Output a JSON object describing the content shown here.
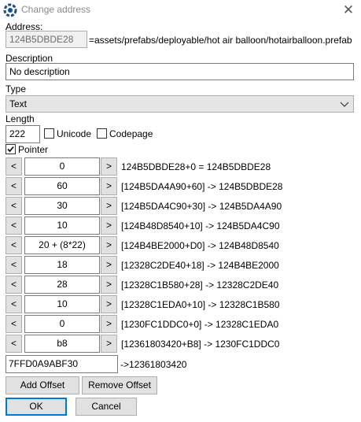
{
  "window": {
    "title": "Change address",
    "close_glyph": "✕",
    "app_icon": "cheat-engine-icon"
  },
  "address": {
    "label": "Address:",
    "value": "124B5DBDE28",
    "symbol_text": "=assets/prefabs/deployable/hot air balloon/hotairballoon.prefab"
  },
  "description": {
    "label": "Description",
    "value": "No description"
  },
  "type": {
    "label": "Type",
    "selected": "Text"
  },
  "length": {
    "label": "Length",
    "value": "222",
    "unicode_label": "Unicode",
    "unicode_checked": false,
    "codepage_label": "Codepage",
    "codepage_checked": false
  },
  "pointer": {
    "label": "Pointer",
    "checked": true
  },
  "offsets": [
    {
      "value": "0",
      "text": "124B5DBDE28+0 = 124B5DBDE28"
    },
    {
      "value": "60",
      "text": "[124B5DA4A90+60] -> 124B5DBDE28"
    },
    {
      "value": "30",
      "text": "[124B5DA4C90+30] -> 124B5DA4A90"
    },
    {
      "value": "10",
      "text": "[124B48D8540+10] -> 124B5DA4C90"
    },
    {
      "value": "20 + (8*22)",
      "text": "[124B4BE2000+D0] -> 124B48D8540"
    },
    {
      "value": "18",
      "text": "[12328C2DE40+18] -> 124B4BE2000"
    },
    {
      "value": "28",
      "text": "[12328C1B580+28] -> 12328C2DE40"
    },
    {
      "value": "10",
      "text": "[12328C1EDA0+10] -> 12328C1B580"
    },
    {
      "value": "0",
      "text": "[1230FC1DDC0+0] -> 12328C1EDA0"
    },
    {
      "value": "b8",
      "text": "[12361803420+B8] -> 1230FC1DDC0"
    }
  ],
  "offset_buttons": {
    "dec": "<",
    "inc": ">"
  },
  "base": {
    "value": "7FFD0A9ABF30",
    "result": "->12361803420"
  },
  "buttons": {
    "add_offset": "Add Offset",
    "remove_offset": "Remove Offset",
    "ok": "OK",
    "cancel": "Cancel"
  }
}
